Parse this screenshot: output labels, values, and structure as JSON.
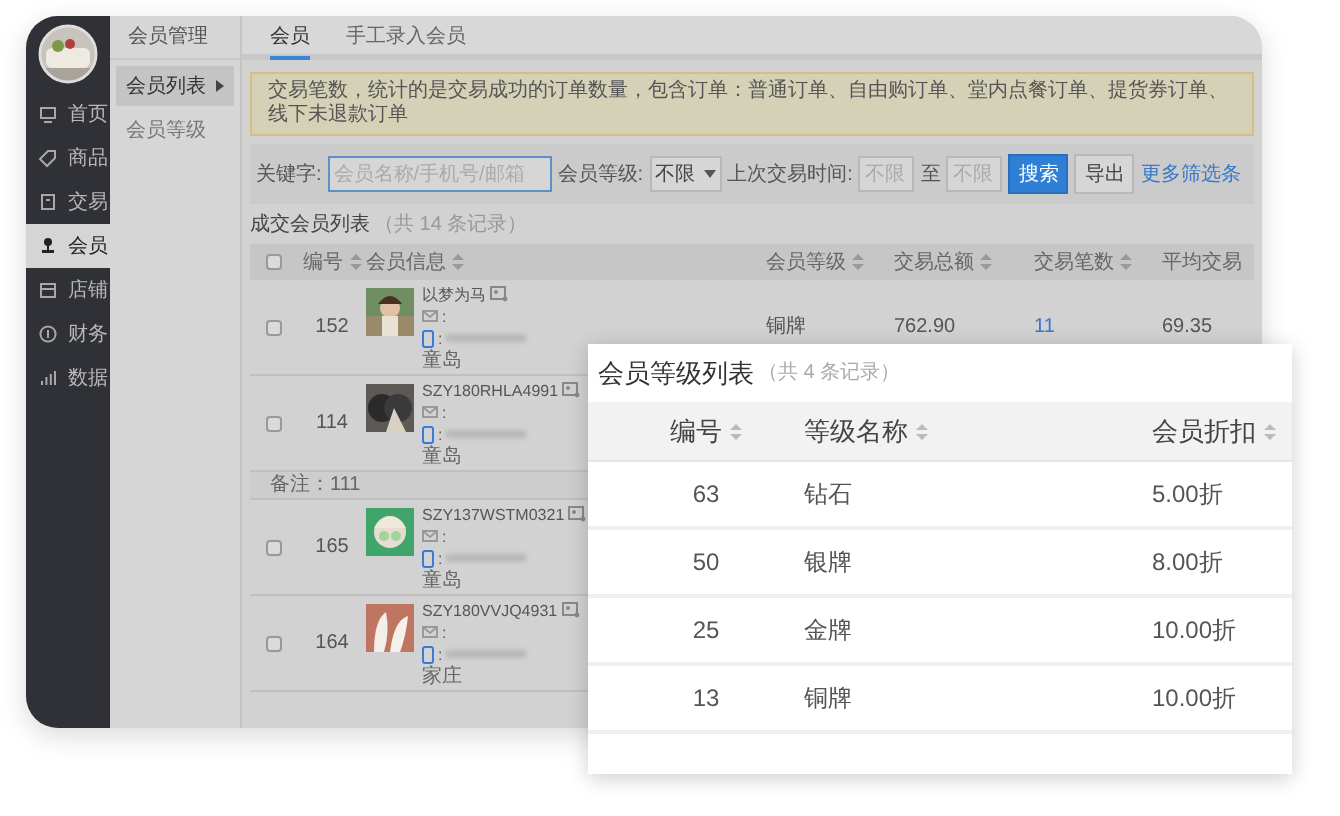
{
  "sidebar": {
    "items": [
      {
        "label": "首页",
        "selected": false
      },
      {
        "label": "商品",
        "selected": false
      },
      {
        "label": "交易",
        "selected": false
      },
      {
        "label": "会员",
        "selected": true
      },
      {
        "label": "店铺",
        "selected": false
      },
      {
        "label": "财务",
        "selected": false
      },
      {
        "label": "数据",
        "selected": false
      }
    ]
  },
  "submenu": {
    "title": "会员管理",
    "items": [
      {
        "label": "会员列表",
        "selected": true
      },
      {
        "label": "会员等级",
        "selected": false
      }
    ]
  },
  "tabs": [
    {
      "label": "会员",
      "selected": true
    },
    {
      "label": "手工录入会员",
      "selected": false
    }
  ],
  "notice": "交易笔数，统计的是交易成功的订单数量，包含订单：普通订单、自由购订单、堂内点餐订单、提货券订单、线下未退款订单",
  "filters": {
    "keyword_label": "关键字:",
    "keyword_placeholder": "会员名称/手机号/邮箱",
    "level_label": "会员等级:",
    "level_value": "不限",
    "time_label": "上次交易时间:",
    "time_from_placeholder": "不限",
    "time_separator": "至",
    "time_to_placeholder": "不限",
    "buttons": [
      {
        "label": "搜索",
        "kind": "primary"
      },
      {
        "label": "导出",
        "kind": "default"
      }
    ],
    "more_link": "更多筛选条"
  },
  "member_table": {
    "title": "成交会员列表",
    "count": "（共 14 条记录）",
    "select_all_checked": false,
    "columns": [
      "编号",
      "会员信息",
      "会员等级",
      "交易总额",
      "交易笔数",
      "平均交易"
    ],
    "rows": [
      {
        "kind": "member",
        "checked": false,
        "id": "152",
        "name": "以梦为马",
        "email": ":",
        "phone": ":",
        "region": "童岛",
        "level": "铜牌",
        "total": "762.90",
        "orders": "11",
        "average": "69.35"
      },
      {
        "kind": "member",
        "checked": false,
        "id": "114",
        "name": "SZY180RHLA4991",
        "email": ":",
        "phone": ":",
        "region": "童岛"
      },
      {
        "kind": "note",
        "text": "备注：111"
      },
      {
        "kind": "member",
        "checked": false,
        "id": "165",
        "name": "SZY137WSTM0321",
        "email": ":",
        "phone": ":",
        "region": "童岛"
      },
      {
        "kind": "member",
        "checked": false,
        "id": "164",
        "name": "SZY180VVJQ4931",
        "email": ":",
        "phone": ":",
        "region": "家庄"
      }
    ]
  },
  "level_card": {
    "title": "会员等级列表",
    "count": "（共 4 条记录）",
    "columns": [
      "编号",
      "等级名称",
      "会员折扣"
    ],
    "rows": [
      {
        "id": "63",
        "name": "钻石",
        "discount": "5.00折"
      },
      {
        "id": "50",
        "name": "银牌",
        "discount": "8.00折"
      },
      {
        "id": "25",
        "name": "金牌",
        "discount": "10.00折"
      },
      {
        "id": "13",
        "name": "铜牌",
        "discount": "10.00折"
      }
    ]
  }
}
